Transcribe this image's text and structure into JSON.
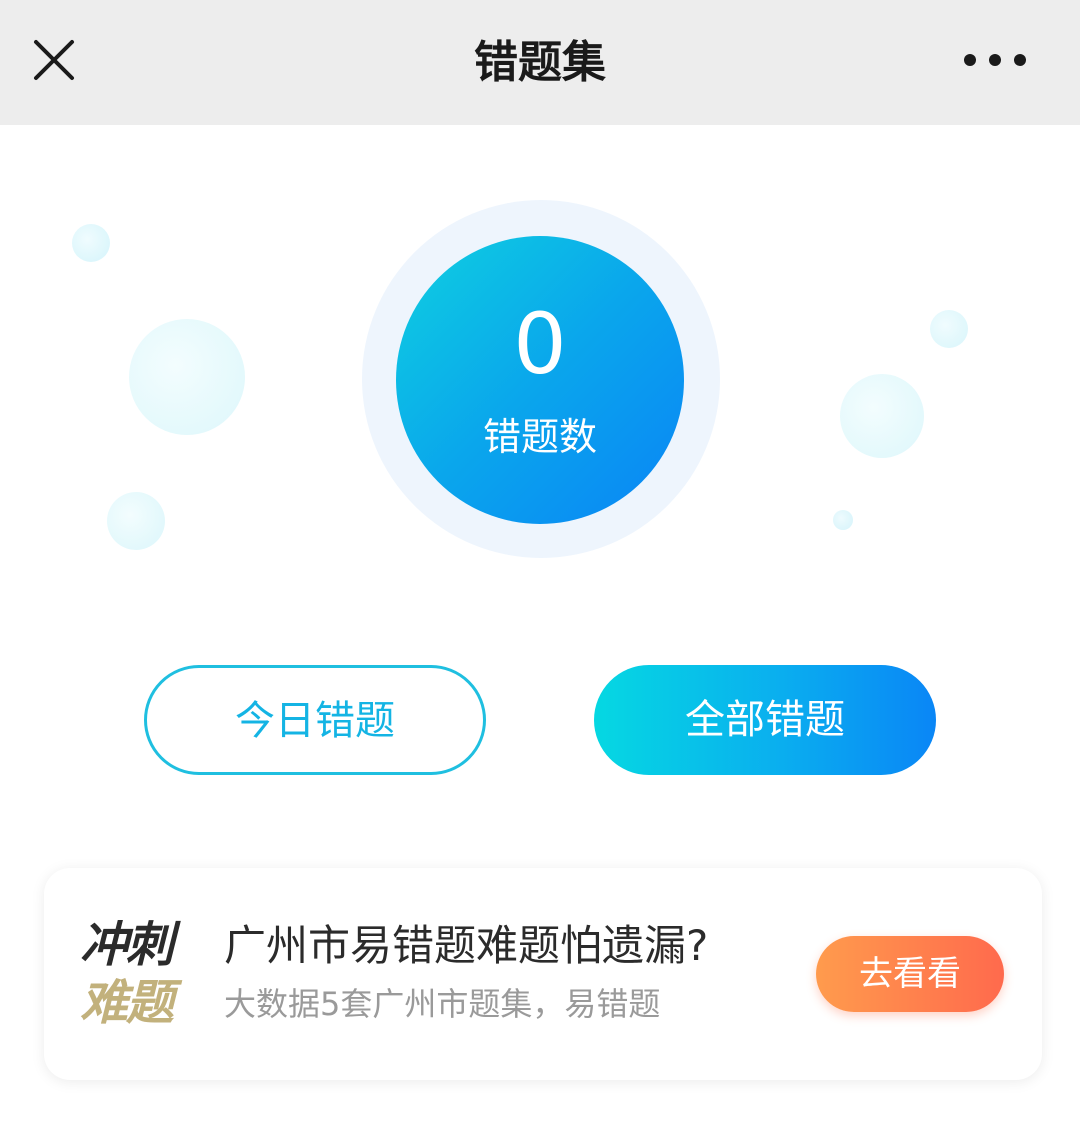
{
  "navbar": {
    "title": "错题集",
    "close_icon": "close-icon",
    "more_icon": "more-dots-icon"
  },
  "counter": {
    "value": "0",
    "label": "错题数"
  },
  "buttons": {
    "today": "今日错题",
    "all": "全部错题"
  },
  "promo": {
    "logo_line1": "冲刺",
    "logo_line2": "难题",
    "title": "广州市易错题难题怕遗漏?",
    "subtitle": "大数据5套广州市题集，易错题",
    "button": "去看看"
  },
  "colors": {
    "navbar_bg": "#ededed",
    "accent_blue": "#0a86f6",
    "accent_cyan": "#05d8e2",
    "promo_orange": "#ff6a4d",
    "logo_gold": "#c2b17c"
  }
}
